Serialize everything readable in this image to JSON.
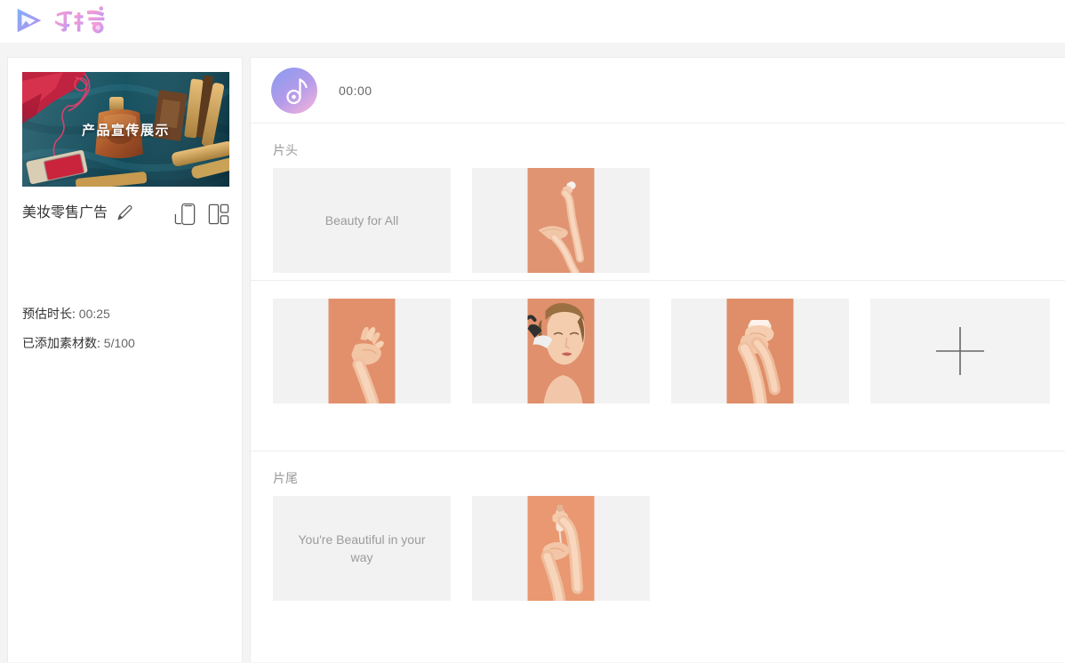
{
  "app": {
    "brand_name": "右糖",
    "logo_icon": "play-triangle-logo-icon",
    "logo_gradient_from": "#6ea8f5",
    "logo_gradient_to": "#b58cf0",
    "word_gradient_from": "#ff9ecb",
    "word_gradient_to": "#c89bf0"
  },
  "sidebar": {
    "thumbnail": {
      "icon": "project-thumbnail",
      "overlay_text": "产品宣传展示",
      "background_color": "#1c5663",
      "accent_color": "#c8392f"
    },
    "project_title": "美妆零售广告",
    "edit_icon": "pencil-edit-icon",
    "ratio_portrait_icon": "phone-portrait-ratio-icon",
    "ratio_layout_icon": "layout-grid-ratio-icon",
    "duration": {
      "label": "预估时长:",
      "value": "00:25"
    },
    "material_count": {
      "label": "已添加素材数:",
      "value": "5/100"
    }
  },
  "main": {
    "music": {
      "icon": "music-note-icon",
      "time": "00:00",
      "gradient_from": "#8f9ef0",
      "gradient_to": "#f0b3dd"
    },
    "sections": [
      {
        "id": "head",
        "label": "片头",
        "cards": [
          {
            "type": "text",
            "text": "Beauty for All",
            "icon": "text-card"
          },
          {
            "type": "image",
            "text": "",
            "icon": "hand-product-drop-image",
            "bg": "#e09472"
          }
        ]
      },
      {
        "id": "body",
        "label": "",
        "cards": [
          {
            "type": "image",
            "text": "",
            "icon": "hand-gesture-image",
            "bg": "#e2906c"
          },
          {
            "type": "image",
            "text": "",
            "icon": "woman-makeup-brush-image",
            "bg": "#e0906d"
          },
          {
            "type": "image",
            "text": "",
            "icon": "hands-cream-jar-image",
            "bg": "#df8e69"
          },
          {
            "type": "add",
            "text": "",
            "icon": "plus-add-material-icon"
          }
        ]
      },
      {
        "id": "tail",
        "label": "片尾",
        "cards": [
          {
            "type": "text",
            "text": "You're Beautiful in your way",
            "icon": "text-card"
          },
          {
            "type": "image",
            "text": "",
            "icon": "hands-serum-dropper-image",
            "bg": "#e99871"
          }
        ]
      }
    ]
  },
  "colors": {
    "page_bg": "#f4f4f4",
    "panel_bg": "#ffffff",
    "card_bg": "#f2f2f2",
    "divider": "#eeeeee",
    "text_primary": "#333333",
    "text_muted": "#999999"
  }
}
